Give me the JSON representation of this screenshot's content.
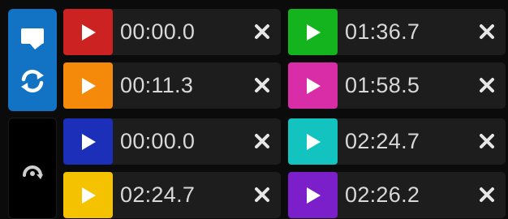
{
  "side_panel": {
    "top_icons": [
      "speech-bubble-icon",
      "sync-icon"
    ],
    "bottom_icons": [
      "rotate-arrow-icon"
    ],
    "top_color": "#1272c4",
    "bottom_color": "#000000"
  },
  "cues": [
    {
      "time": "00:00.0",
      "color": "#cc2222",
      "icon": "play-icon"
    },
    {
      "time": "01:36.7",
      "color": "#14b41e",
      "icon": "play-icon"
    },
    {
      "time": "00:11.3",
      "color": "#f58a0a",
      "icon": "play-icon"
    },
    {
      "time": "01:58.5",
      "color": "#d92da8",
      "icon": "play-icon"
    },
    {
      "time": "00:00.0",
      "color": "#1c2fb8",
      "icon": "play-icon"
    },
    {
      "time": "02:24.7",
      "color": "#12c3c0",
      "icon": "play-icon"
    },
    {
      "time": "02:24.7",
      "color": "#f5c200",
      "icon": "play-icon"
    },
    {
      "time": "02:26.2",
      "color": "#7a1fc9",
      "icon": "play-icon"
    }
  ],
  "colors": {
    "cue_background": "#1d1d1d",
    "time_text": "#d8d8d8",
    "close_icon": "#e6e6e6"
  }
}
